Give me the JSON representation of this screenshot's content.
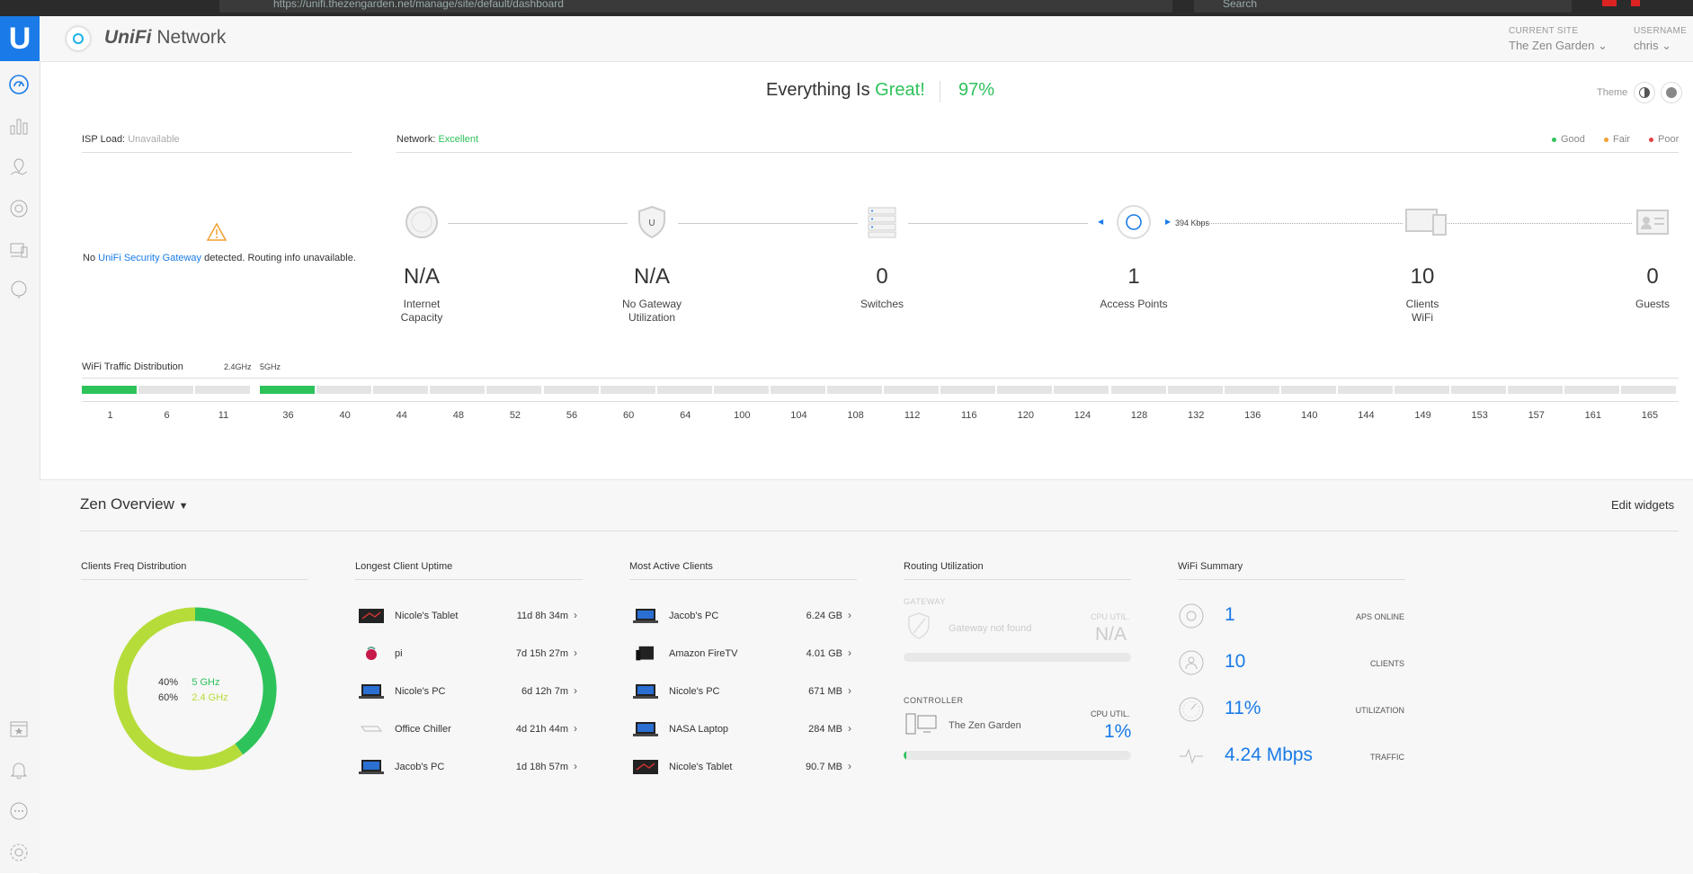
{
  "browser": {
    "url": "https://unifi.thezengarden.net/manage/site/default/dashboard",
    "search_placeholder": "Search"
  },
  "header": {
    "brand_prefix": "UniFi",
    "brand_suffix": "Network",
    "current_site_label": "CURRENT SITE",
    "current_site": "The Zen Garden",
    "username_label": "USERNAME",
    "username": "chris"
  },
  "status": {
    "message_prefix": "Everything Is",
    "message_status": "Great!",
    "score": "97%",
    "theme_label": "Theme"
  },
  "isp": {
    "label": "ISP Load:",
    "value": "Unavailable",
    "message_prefix": "No",
    "message_link": "UniFi Security Gateway",
    "message_suffix": "detected. Routing info unavailable."
  },
  "network": {
    "label": "Network:",
    "value": "Excellent",
    "legend": [
      "Good",
      "Fair",
      "Poor"
    ],
    "legend_colors": [
      "#2ec25b",
      "#f0a030",
      "#e04040"
    ]
  },
  "topology": {
    "rate": "394 Kbps",
    "nodes": [
      {
        "value": "N/A",
        "label1": "Internet",
        "label2": "Capacity"
      },
      {
        "value": "N/A",
        "label1": "No Gateway",
        "label2": "Utilization"
      },
      {
        "value": "0",
        "label1": "Switches",
        "label2": ""
      },
      {
        "value": "1",
        "label1": "Access Points",
        "label2": ""
      },
      {
        "value": "10",
        "label1": "Clients",
        "label2": "WiFi"
      },
      {
        "value": "0",
        "label1": "Guests",
        "label2": ""
      }
    ]
  },
  "wifi_traffic": {
    "title": "WiFi Traffic Distribution",
    "band_24": "2.4GHz",
    "band_5": "5GHz",
    "channels_24": [
      "1",
      "6",
      "11"
    ],
    "channels_5": [
      "36",
      "40",
      "44",
      "48",
      "52",
      "56",
      "60",
      "64",
      "100",
      "104",
      "108",
      "112",
      "116",
      "120",
      "124",
      "128",
      "132",
      "136",
      "140",
      "144",
      "149",
      "153",
      "157",
      "161",
      "165"
    ],
    "active_color": "#2ec25b"
  },
  "overview": {
    "title": "Zen Overview",
    "edit_label": "Edit widgets"
  },
  "clients_freq": {
    "title": "Clients Freq Distribution",
    "chart_data": {
      "type": "pie",
      "slices": [
        {
          "name": "5 GHz",
          "value": 40,
          "color": "#2ec25b"
        },
        {
          "name": "2.4 GHz",
          "value": 60,
          "color": "#b6dc3a"
        }
      ]
    },
    "labels": [
      {
        "pct": "40%",
        "name": "5 GHz"
      },
      {
        "pct": "60%",
        "name": "2.4 GHz"
      }
    ]
  },
  "uptime": {
    "title": "Longest Client Uptime",
    "rows": [
      {
        "name": "Nicole's Tablet",
        "value": "11d 8h 34m",
        "icon": "tablet-icon"
      },
      {
        "name": "pi",
        "value": "7d 15h 27m",
        "icon": "raspberry-pi-icon"
      },
      {
        "name": "Nicole's PC",
        "value": "6d 12h 7m",
        "icon": "laptop-icon"
      },
      {
        "name": "Office Chiller",
        "value": "4d 21h 44m",
        "icon": "device-icon"
      },
      {
        "name": "Jacob's PC",
        "value": "1d 18h 57m",
        "icon": "laptop-icon"
      }
    ]
  },
  "active": {
    "title": "Most Active Clients",
    "rows": [
      {
        "name": "Jacob's PC",
        "value": "6.24 GB",
        "icon": "laptop-icon"
      },
      {
        "name": "Amazon FireTV",
        "value": "4.01 GB",
        "icon": "tv-box-icon"
      },
      {
        "name": "Nicole's PC",
        "value": "671 MB",
        "icon": "laptop-icon"
      },
      {
        "name": "NASA Laptop",
        "value": "284 MB",
        "icon": "laptop-icon"
      },
      {
        "name": "Nicole's Tablet",
        "value": "90.7 MB",
        "icon": "tablet-icon"
      }
    ]
  },
  "routing": {
    "title": "Routing Utilization",
    "gateway_label": "GATEWAY",
    "gateway_text": "Gateway not found",
    "cpu_label": "CPU UTIL.",
    "gateway_cpu": "N/A",
    "controller_label": "CONTROLLER",
    "controller_name": "The Zen Garden",
    "controller_cpu": "1%",
    "controller_cpu_fraction": 0.01
  },
  "wifi_summary": {
    "title": "WiFi Summary",
    "rows": [
      {
        "value": "1",
        "label": "APS ONLINE",
        "icon": "ap-icon"
      },
      {
        "value": "10",
        "label": "CLIENTS",
        "icon": "clients-icon"
      },
      {
        "value": "11%",
        "label": "UTILIZATION",
        "icon": "gauge-icon"
      },
      {
        "value": "4.24 Mbps",
        "label": "TRAFFIC",
        "icon": "traffic-icon"
      }
    ]
  }
}
